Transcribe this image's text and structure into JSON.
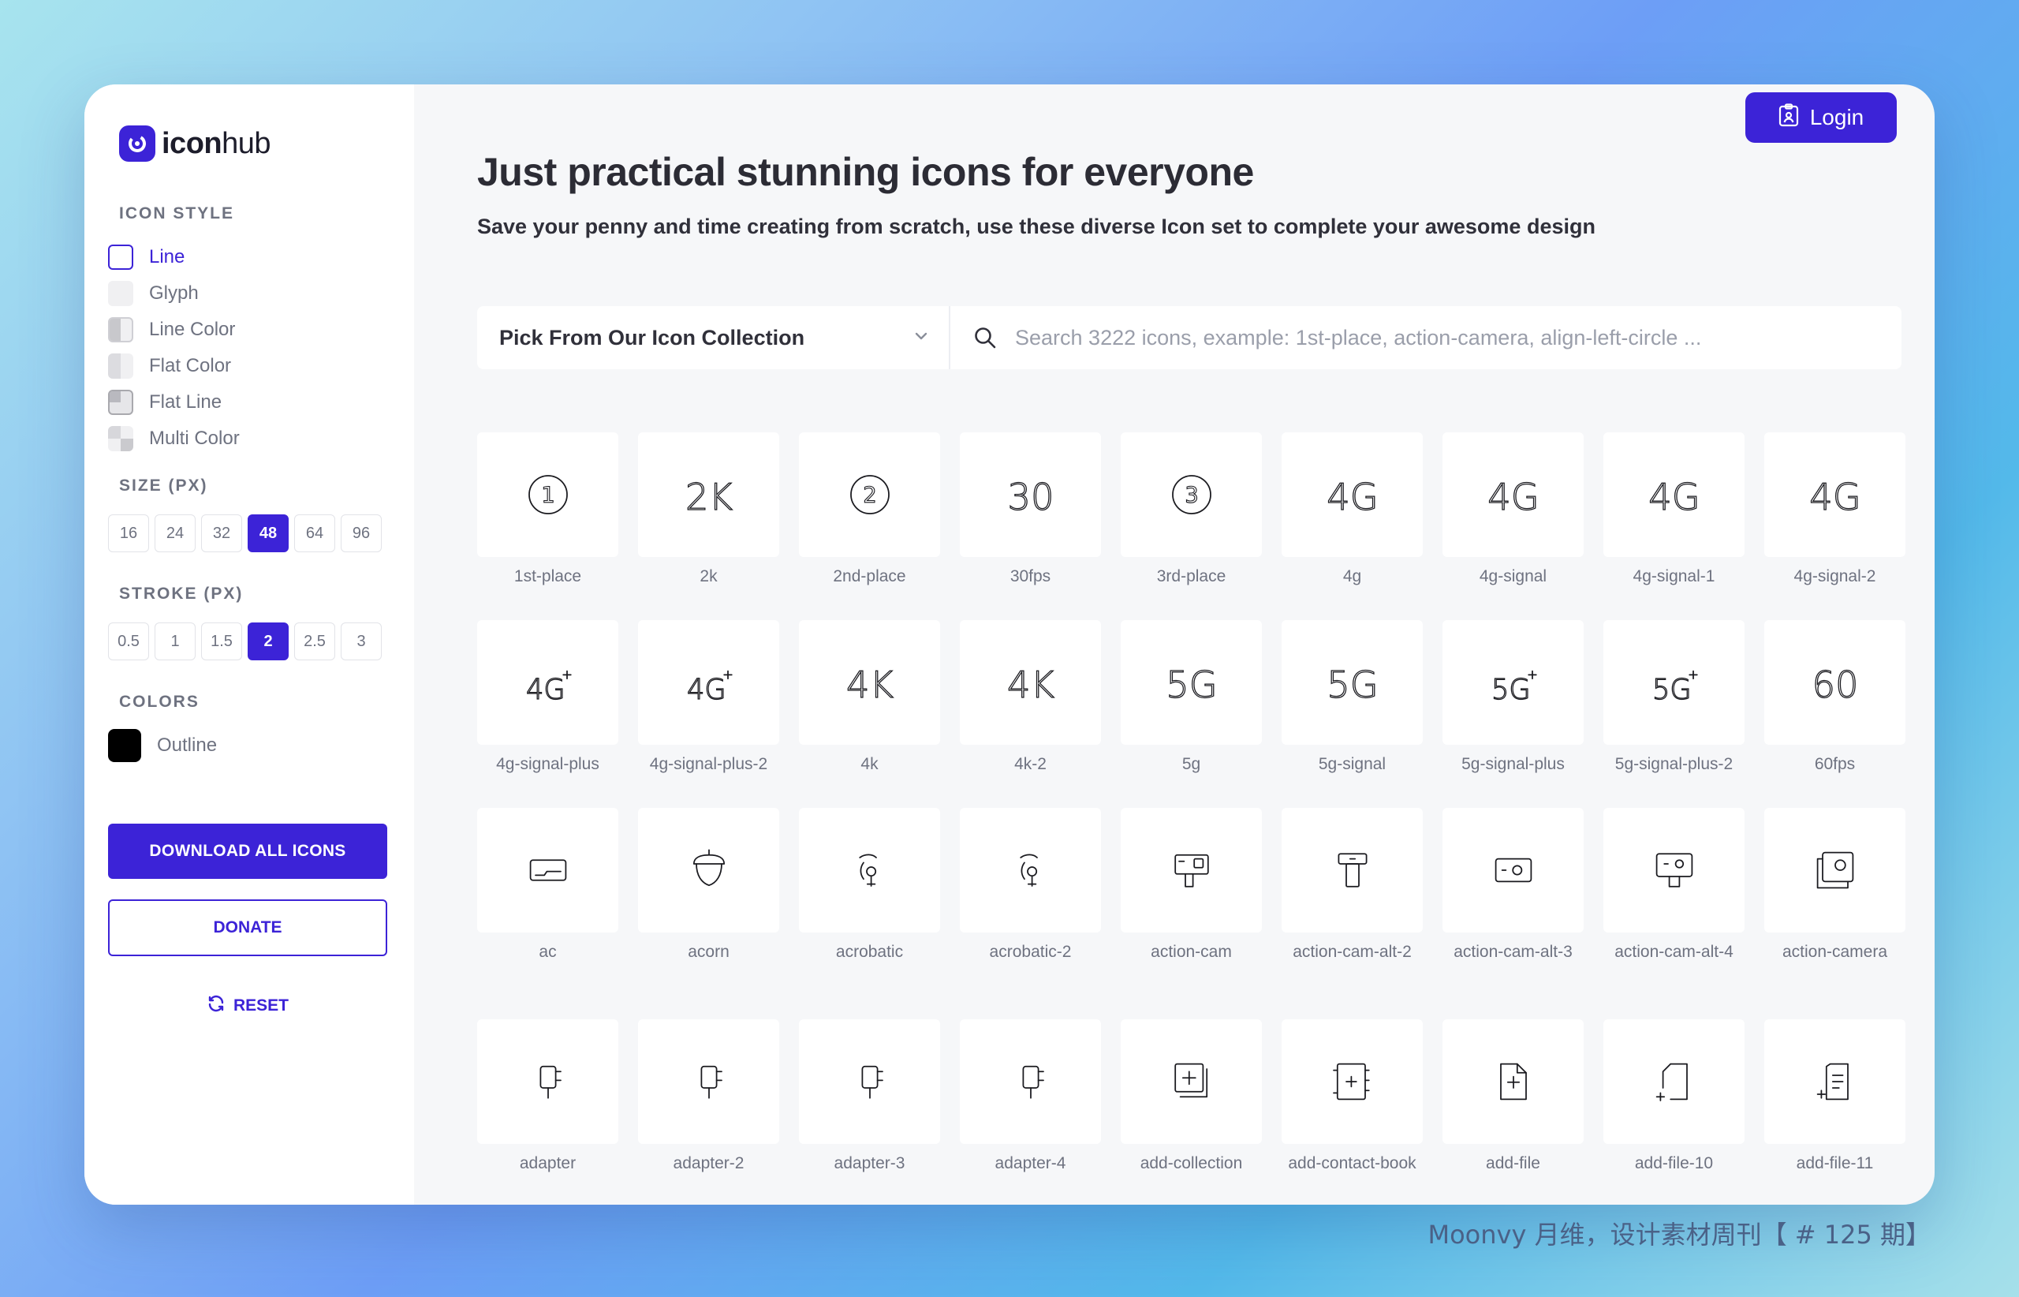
{
  "brand": {
    "name_bold": "icon",
    "name_light": "hub"
  },
  "sidebar": {
    "icon_style_title": "ICON STYLE",
    "styles": [
      {
        "label": "Line",
        "active": true,
        "kind": "line"
      },
      {
        "label": "Glyph",
        "active": false,
        "kind": "glyph"
      },
      {
        "label": "Line Color",
        "active": false,
        "kind": "linecolor"
      },
      {
        "label": "Flat Color",
        "active": false,
        "kind": "flatcolor"
      },
      {
        "label": "Flat Line",
        "active": false,
        "kind": "flatline"
      },
      {
        "label": "Multi Color",
        "active": false,
        "kind": "multi"
      }
    ],
    "size_title": "SIZE (PX)",
    "sizes": [
      "16",
      "24",
      "32",
      "48",
      "64",
      "96"
    ],
    "size_selected": "48",
    "stroke_title": "STROKE (PX)",
    "strokes": [
      "0.5",
      "1",
      "1.5",
      "2",
      "2.5",
      "3"
    ],
    "stroke_selected": "2",
    "colors_title": "COLORS",
    "outline_label": "Outline",
    "outline_color": "#000000",
    "download_label": "DOWNLOAD ALL ICONS",
    "donate_label": "DONATE",
    "reset_label": "RESET"
  },
  "header": {
    "login_label": "Login",
    "headline": "Just practical stunning icons for everyone",
    "subline": "Save your penny and time creating from scratch, use these diverse Icon set to complete your awesome design"
  },
  "search": {
    "collection_label": "Pick From Our Icon Collection",
    "placeholder": "Search 3222 icons, example: 1st-place, action-camera, align-left-circle ..."
  },
  "icons": [
    [
      {
        "label": "1st-place",
        "glyph": "circle-1"
      },
      {
        "label": "2k",
        "glyph": "2K"
      },
      {
        "label": "2nd-place",
        "glyph": "circle-2"
      },
      {
        "label": "30fps",
        "glyph": "30"
      },
      {
        "label": "3rd-place",
        "glyph": "circle-3"
      },
      {
        "label": "4g",
        "glyph": "4G"
      },
      {
        "label": "4g-signal",
        "glyph": "4G"
      },
      {
        "label": "4g-signal-1",
        "glyph": "4G"
      },
      {
        "label": "4g-signal-2",
        "glyph": "4G"
      }
    ],
    [
      {
        "label": "4g-signal-plus",
        "glyph": "4G+"
      },
      {
        "label": "4g-signal-plus-2",
        "glyph": "4G+"
      },
      {
        "label": "4k",
        "glyph": "4K"
      },
      {
        "label": "4k-2",
        "glyph": "4K"
      },
      {
        "label": "5g",
        "glyph": "5G"
      },
      {
        "label": "5g-signal",
        "glyph": "5G"
      },
      {
        "label": "5g-signal-plus",
        "glyph": "5G+"
      },
      {
        "label": "5g-signal-plus-2",
        "glyph": "5G+"
      },
      {
        "label": "60fps",
        "glyph": "60"
      }
    ],
    [
      {
        "label": "ac",
        "glyph": "ac"
      },
      {
        "label": "acorn",
        "glyph": "acorn"
      },
      {
        "label": "acrobatic",
        "glyph": "acrobatic"
      },
      {
        "label": "acrobatic-2",
        "glyph": "acrobatic"
      },
      {
        "label": "action-cam",
        "glyph": "action-cam"
      },
      {
        "label": "action-cam-alt-2",
        "glyph": "action-cam-alt-2"
      },
      {
        "label": "action-cam-alt-3",
        "glyph": "action-cam-alt-3"
      },
      {
        "label": "action-cam-alt-4",
        "glyph": "action-cam-alt-4"
      },
      {
        "label": "action-camera",
        "glyph": "action-camera"
      }
    ],
    [
      {
        "label": "adapter",
        "glyph": "adapter"
      },
      {
        "label": "adapter-2",
        "glyph": "adapter"
      },
      {
        "label": "adapter-3",
        "glyph": "adapter"
      },
      {
        "label": "adapter-4",
        "glyph": "adapter"
      },
      {
        "label": "add-collection",
        "glyph": "add-collection"
      },
      {
        "label": "add-contact-book",
        "glyph": "add-contact-book"
      },
      {
        "label": "add-file",
        "glyph": "add-file"
      },
      {
        "label": "add-file-10",
        "glyph": "add-file-10"
      },
      {
        "label": "add-file-11",
        "glyph": "add-file-11"
      }
    ]
  ],
  "footer": {
    "note": "Moonvy 月维，设计素材周刊【 # 125 期】"
  },
  "colors": {
    "accent": "#3c23d7",
    "muted": "#6e7280",
    "panel": "#f6f7f9"
  }
}
